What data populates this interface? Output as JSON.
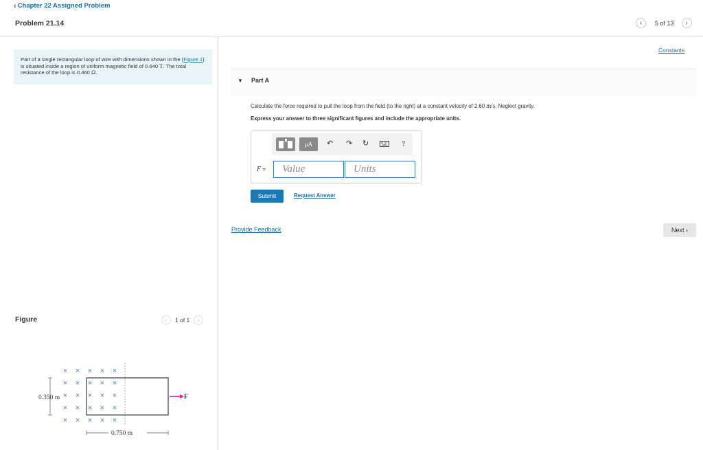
{
  "header": {
    "back_link": "Chapter 22 Assigned Problem",
    "problem_title": "Problem 21.14",
    "pager_text": "5 of 13"
  },
  "problem": {
    "statement_pre": "Part of a single rectangular loop of wire with dimensions shown in the (",
    "figure_link": "Figure 1",
    "statement_mid": ") is situated inside a region of uniform magnetic field of 0.640 ",
    "field_unit": "T",
    "statement_mid2": ". The total resistance of the loop is 0.460 ",
    "resistance_unit": "Ω",
    "statement_post": "."
  },
  "figure": {
    "label": "Figure",
    "pager_text": "1 of 1",
    "height_label": "0.350 m",
    "width_label": "0.750 m",
    "force_label": "F",
    "field_symbol": "×",
    "arrow_color": "#e8178a"
  },
  "constants_link": "Constants",
  "part": {
    "title": "Part A",
    "question_pre": "Calculate the force required to pull the loop from the field (to the right) at a constant velocity of 2.60 ",
    "question_unit": "m/s",
    "question_post": ". Neglect gravity.",
    "instruction": "Express your answer to three significant figures and include the appropriate units.",
    "toolbar": {
      "templates_icon": "templates-icon",
      "units_button": "μA",
      "undo_icon": "undo-icon",
      "redo_icon": "redo-icon",
      "reset_icon": "reset-icon",
      "keyboard_icon": "keyboard-icon",
      "help": "?"
    },
    "variable": "F",
    "equals": "=",
    "value_placeholder": "Value",
    "units_placeholder": "Units",
    "submit_label": "Submit",
    "request_answer": "Request Answer"
  },
  "feedback_link": "Provide Feedback",
  "next_label": "Next"
}
